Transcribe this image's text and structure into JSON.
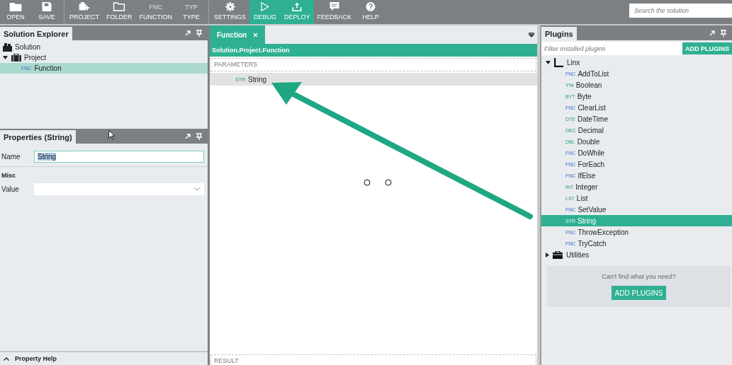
{
  "toolbar": {
    "buttons": [
      {
        "label": "OPEN",
        "kind": "folder",
        "active": false
      },
      {
        "label": "SAVE",
        "kind": "save",
        "active": false
      },
      {
        "label": "PROJECT",
        "kind": "project",
        "active": false
      },
      {
        "label": "FOLDER",
        "kind": "outline-folder",
        "active": false
      },
      {
        "label": "FUNCTION",
        "kind": "glyph",
        "glyph": "FNC",
        "active": false
      },
      {
        "label": "TYPE",
        "kind": "glyph",
        "glyph": "TYP",
        "active": false
      },
      {
        "label": "SETTINGS",
        "kind": "gear",
        "active": false
      },
      {
        "label": "DEBUG",
        "kind": "play",
        "active": true
      },
      {
        "label": "DEPLOY",
        "kind": "upload",
        "active": true
      },
      {
        "label": "FEEDBACK",
        "kind": "chat",
        "active": false
      },
      {
        "label": "HELP",
        "kind": "help",
        "active": false
      }
    ],
    "search": {
      "placeholder": "Search the solution"
    }
  },
  "solution_explorer": {
    "title": "Solution Explorer",
    "tree": [
      {
        "label": "Solution",
        "kind": "solution",
        "selected": false,
        "children": [
          {
            "label": "Project",
            "kind": "project",
            "selected": false,
            "expanded": true,
            "children": [
              {
                "label": "Function",
                "kind": "tag",
                "tag": "FNC",
                "selected": true
              }
            ]
          }
        ]
      }
    ]
  },
  "properties": {
    "title": "Properties (String)",
    "fields": [
      {
        "label": "Name",
        "kind": "text",
        "value": "String"
      },
      {
        "kind": "section",
        "label": "Misc"
      },
      {
        "label": "Value",
        "kind": "dropdown"
      }
    ],
    "help": "Property Help"
  },
  "editor": {
    "tab": "Function",
    "path": "Solution.Project.Function",
    "parameters_label": "PARAMETERS",
    "parameters": [
      {
        "tag": "STR",
        "name": "String"
      }
    ],
    "result_label": "RESULT"
  },
  "plugins": {
    "title": "Plugins",
    "filter_placeholder": "Filter installed plugins",
    "add_button": "ADD PLUGINS",
    "groups": [
      {
        "name": "Linx",
        "kind": "linx",
        "expanded": true,
        "children": [
          {
            "tag": "FNC",
            "kind": "function",
            "name": "AddToList",
            "selected": false
          },
          {
            "tag": "Y\\N",
            "kind": "type",
            "name": "Boolean",
            "selected": false
          },
          {
            "tag": "BYT",
            "kind": "type",
            "name": "Byte",
            "selected": false
          },
          {
            "tag": "FNC",
            "kind": "function",
            "name": "ClearList",
            "selected": false
          },
          {
            "tag": "DTE",
            "kind": "type",
            "name": "DateTime",
            "selected": false
          },
          {
            "tag": "DEC",
            "kind": "type",
            "name": "Decimal",
            "selected": false
          },
          {
            "tag": "DBL",
            "kind": "type",
            "name": "Double",
            "selected": false
          },
          {
            "tag": "FNC",
            "kind": "function",
            "name": "DoWhile",
            "selected": false
          },
          {
            "tag": "FNC",
            "kind": "function",
            "name": "ForEach",
            "selected": false
          },
          {
            "tag": "FNC",
            "kind": "function",
            "name": "IfElse",
            "selected": false
          },
          {
            "tag": "INT",
            "kind": "type",
            "name": "Integer",
            "selected": false
          },
          {
            "tag": "LST",
            "kind": "type",
            "name": "List",
            "selected": false
          },
          {
            "tag": "FNC",
            "kind": "function",
            "name": "SetValue",
            "selected": false
          },
          {
            "tag": "STR",
            "kind": "type",
            "name": "String",
            "selected": true
          },
          {
            "tag": "FNC",
            "kind": "function",
            "name": "ThrowException",
            "selected": false
          },
          {
            "tag": "FNC",
            "kind": "function",
            "name": "TryCatch",
            "selected": false
          }
        ]
      },
      {
        "name": "Utilities",
        "kind": "toolbox",
        "expanded": false
      }
    ],
    "help_text": "Can't find what you need?",
    "help_button": "ADD PLUGINS"
  }
}
